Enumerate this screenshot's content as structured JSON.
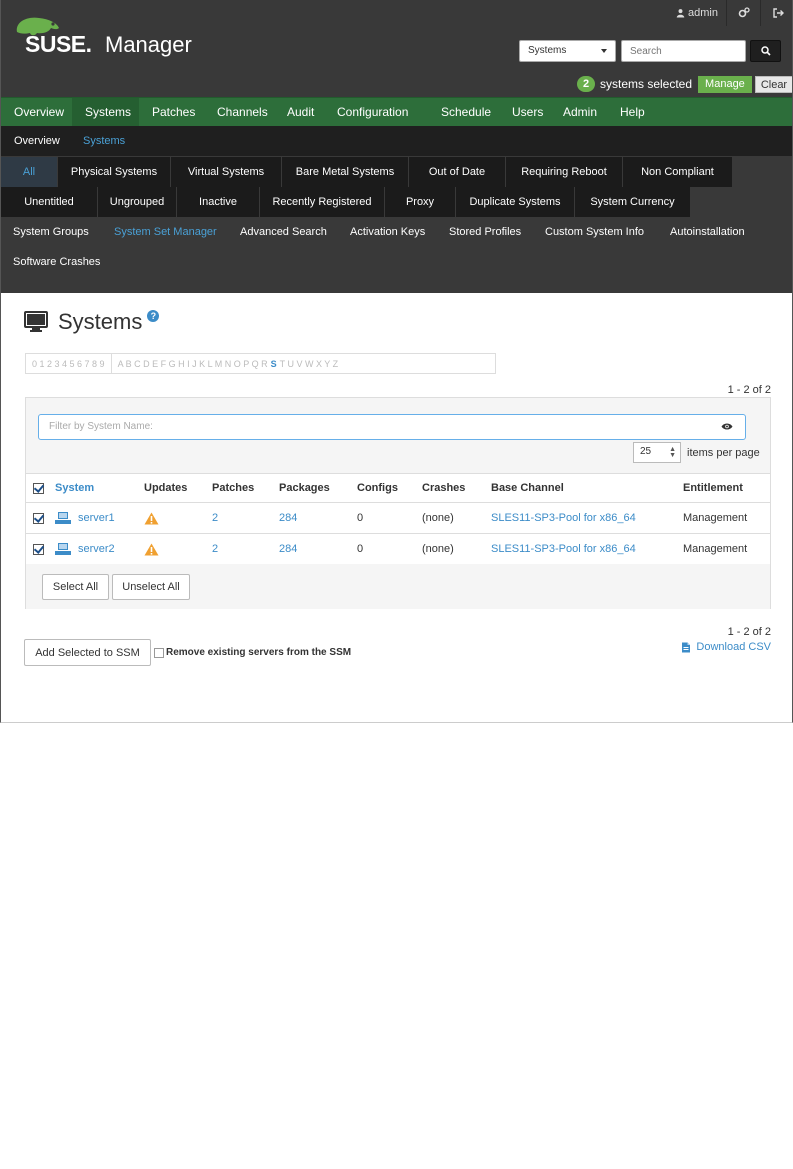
{
  "header": {
    "brand": "SUSE.",
    "product": "Manager",
    "user_label": "admin",
    "search_scope": "Systems",
    "search_placeholder": "Search",
    "selected_count": "2",
    "selected_label": "systems selected",
    "manage_label": "Manage",
    "clear_label": "Clear",
    "brand_color": "#6ab04c"
  },
  "main_nav": [
    {
      "label": "Overview"
    },
    {
      "label": "Systems"
    },
    {
      "label": "Patches"
    },
    {
      "label": "Channels"
    },
    {
      "label": "Audit"
    },
    {
      "label": "Configuration"
    },
    {
      "label": "Schedule"
    },
    {
      "label": "Users"
    },
    {
      "label": "Admin"
    },
    {
      "label": "Help"
    }
  ],
  "sub_nav": {
    "overview": "Overview",
    "systems": "Systems"
  },
  "tabs": {
    "all": "All",
    "physical": "Physical Systems",
    "virtual": "Virtual Systems",
    "bare_metal": "Bare Metal Systems",
    "out_of_date": "Out of Date",
    "requiring_reboot": "Requiring Reboot",
    "non_compliant": "Non Compliant",
    "unentitled": "Unentitled",
    "ungrouped": "Ungrouped",
    "inactive": "Inactive",
    "recently_registered": "Recently Registered",
    "proxy": "Proxy",
    "duplicate": "Duplicate Systems",
    "currency": "System Currency"
  },
  "links": {
    "system_groups": "System Groups",
    "ssm": "System Set Manager",
    "advanced_search": "Advanced Search",
    "activation_keys": "Activation Keys",
    "stored_profiles": "Stored Profiles",
    "custom_info": "Custom System Info",
    "autoinstallation": "Autoinstallation",
    "software_crashes": "Software Crashes"
  },
  "page": {
    "title": "Systems",
    "help": "?",
    "alpha_digits": "0 1 2 3 4 5 6 7 8 9",
    "alpha_letters_before": "A B C D E F G H I J K L M N O P Q R",
    "alpha_active": "S",
    "alpha_letters_after": "T U V W X Y Z",
    "count_text": "1 - 2 of 2",
    "filter_placeholder": "Filter by System Name:",
    "per_page_value": "25",
    "per_page_label": "items per page",
    "select_all": "Select All",
    "unselect_all": "Unselect All",
    "add_selected": "Add Selected to SSM",
    "remove_existing": "Remove existing servers from the SSM",
    "download_csv": "Download CSV"
  },
  "table": {
    "columns": [
      "System",
      "Updates",
      "Patches",
      "Packages",
      "Configs",
      "Crashes",
      "Base Channel",
      "Entitlement"
    ],
    "rows": [
      {
        "system": "server1",
        "patches": "2",
        "packages": "284",
        "configs": "0",
        "crashes": "(none)",
        "base_channel": "SLES11-SP3-Pool for x86_64",
        "entitlement": "Management"
      },
      {
        "system": "server2",
        "patches": "2",
        "packages": "284",
        "configs": "0",
        "crashes": "(none)",
        "base_channel": "SLES11-SP3-Pool for x86_64",
        "entitlement": "Management"
      }
    ]
  }
}
